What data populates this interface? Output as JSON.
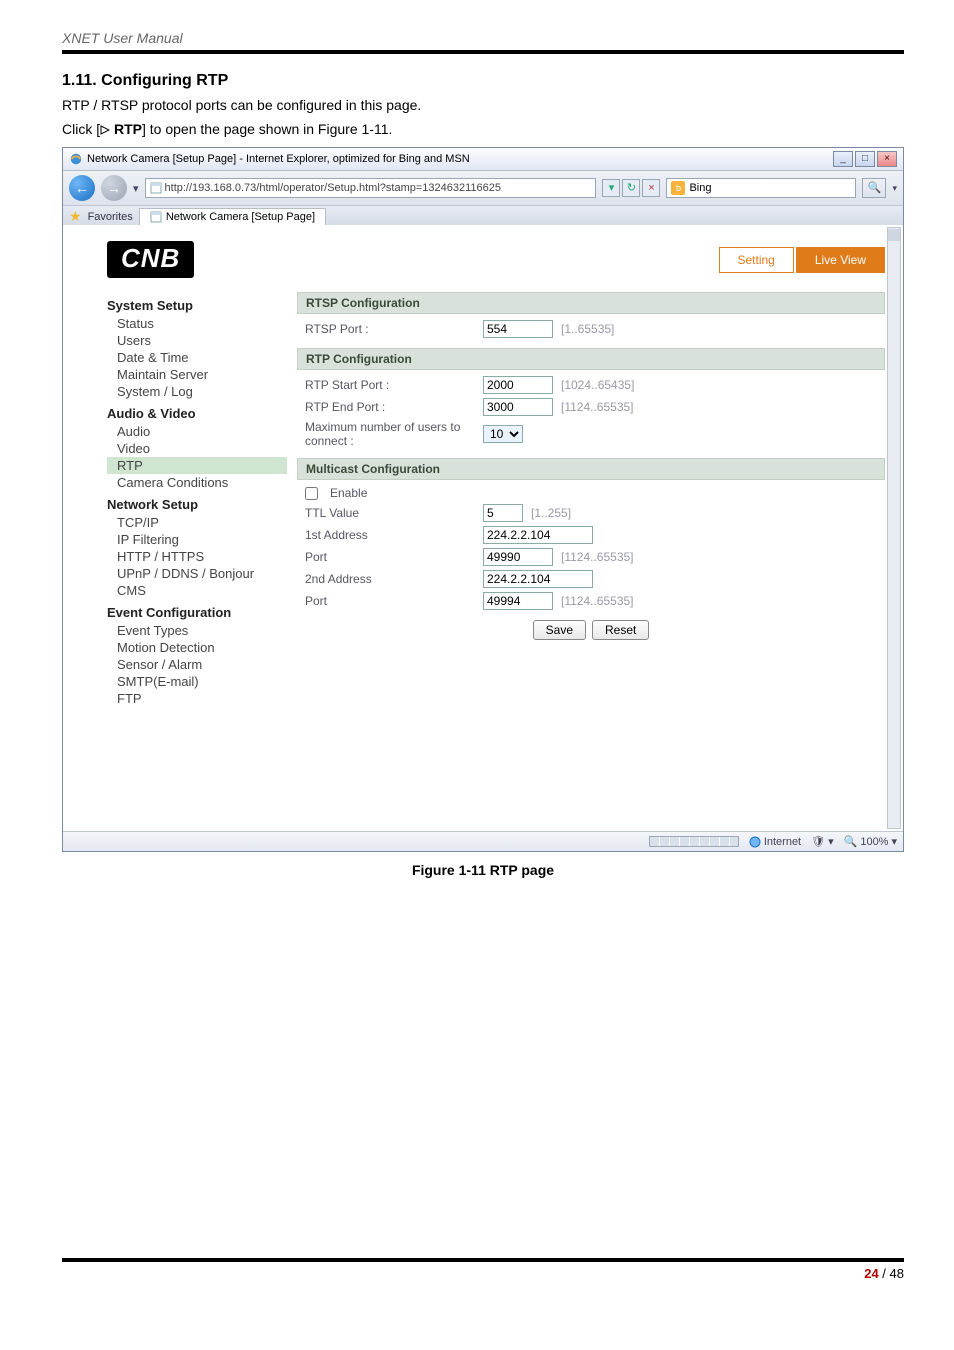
{
  "doc": {
    "header": "XNET User Manual",
    "section_number": "1.11. Configuring RTP",
    "intro1": "RTP / RTSP protocol ports can be configured in this page.",
    "intro2a": "Click [",
    "intro2b": " RTP",
    "intro2c": "] to open the page shown in Figure 1-11.",
    "figure_caption": "Figure 1-11 RTP page",
    "page_current": "24",
    "page_sep": " / ",
    "page_total": "48"
  },
  "browser": {
    "title": "Network Camera [Setup Page] - Internet Explorer, optimized for Bing and MSN",
    "url": "http://193.168.0.73/html/operator/Setup.html?stamp=1324632116625",
    "search_engine": "Bing",
    "favorites_label": "Favorites",
    "tab_label": "Network Camera [Setup Page]",
    "status_zone": "Internet",
    "zoom": "100%"
  },
  "app": {
    "logo": "CNB",
    "btn_setting": "Setting",
    "btn_liveview": "Live View"
  },
  "sidebar": {
    "g1_title": "System Setup",
    "g1_items": [
      "Status",
      "Users",
      "Date & Time",
      "Maintain Server",
      "System / Log"
    ],
    "g2_title": "Audio & Video",
    "g2_items": [
      "Audio",
      "Video",
      "RTP",
      "Camera Conditions"
    ],
    "g2_active_index": 2,
    "g3_title": "Network Setup",
    "g3_items": [
      "TCP/IP",
      "IP Filtering",
      "HTTP / HTTPS",
      "UPnP / DDNS / Bonjour",
      "CMS"
    ],
    "g4_title": "Event Configuration",
    "g4_items": [
      "Event Types",
      "Motion Detection",
      "Sensor / Alarm",
      "SMTP(E-mail)",
      "FTP"
    ]
  },
  "form": {
    "rtsp_section": "RTSP Configuration",
    "rtsp_port_label": "RTSP Port :",
    "rtsp_port_value": "554",
    "rtsp_port_hint": "[1..65535]",
    "rtp_section": "RTP Configuration",
    "rtp_start_label": "RTP Start Port :",
    "rtp_start_value": "2000",
    "rtp_start_hint": "[1024..65435]",
    "rtp_end_label": "RTP End Port :",
    "rtp_end_value": "3000",
    "rtp_end_hint": "[1124..65535]",
    "max_users_label": "Maximum number of users to connect :",
    "max_users_value": "10",
    "mc_section": "Multicast Configuration",
    "enable_label": "Enable",
    "ttl_label": "TTL Value",
    "ttl_value": "5",
    "ttl_hint": "[1..255]",
    "addr1_label": "1st Address",
    "addr1_value": "224.2.2.104",
    "port1_label": "Port",
    "port1_value": "49990",
    "port1_hint": "[1124..65535]",
    "addr2_label": "2nd Address",
    "addr2_value": "224.2.2.104",
    "port2_label": "Port",
    "port2_value": "49994",
    "port2_hint": "[1124..65535]",
    "btn_save": "Save",
    "btn_reset": "Reset"
  }
}
